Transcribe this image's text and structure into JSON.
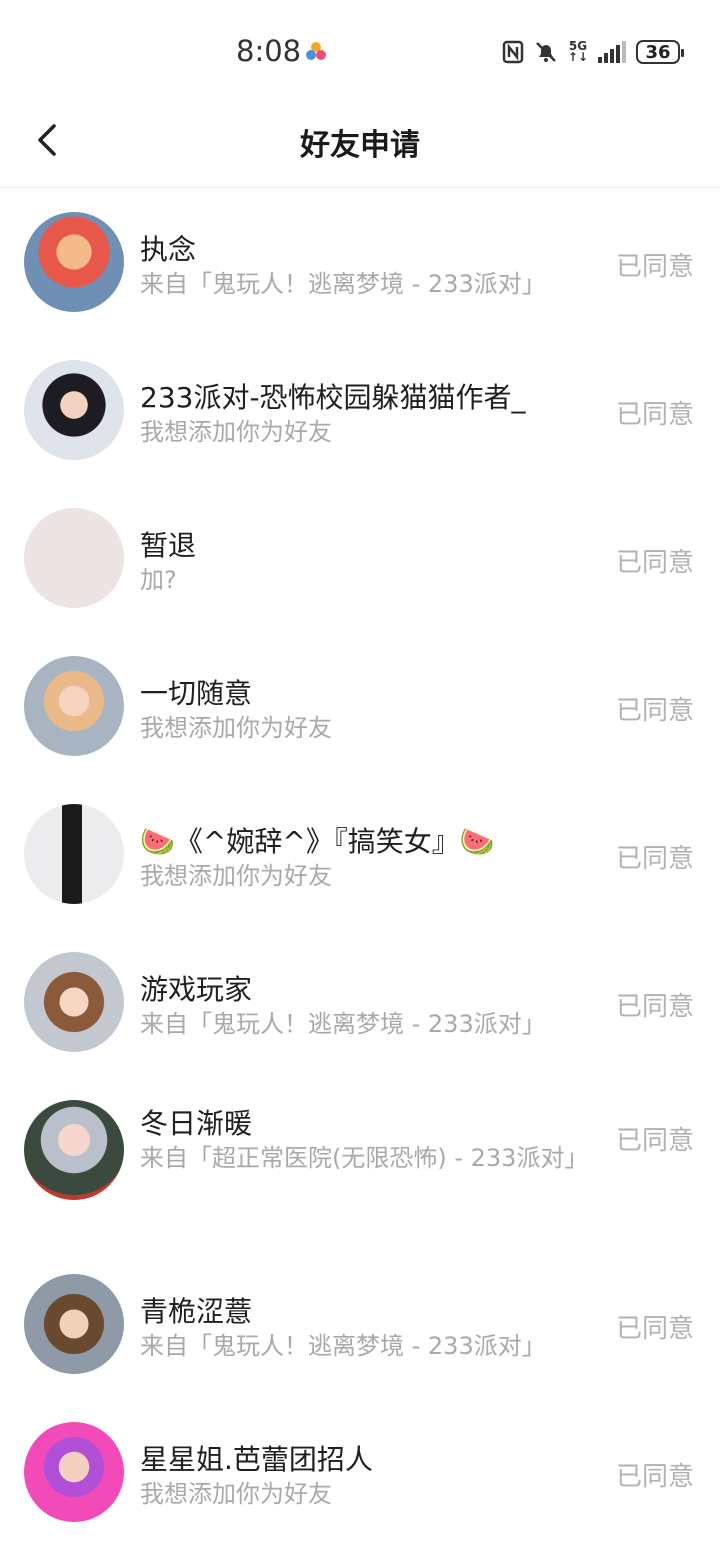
{
  "status_bar": {
    "time": "8:08",
    "network": "5G",
    "battery": "36"
  },
  "header": {
    "title": "好友申请"
  },
  "requests": [
    {
      "name": "执念",
      "message": "来自「鬼玩人！逃离梦境 - 233派对」",
      "status": "已同意"
    },
    {
      "name": "233派对-恐怖校园躲猫猫作者_",
      "message": "我想添加你为好友",
      "status": "已同意"
    },
    {
      "name": "暂退",
      "message": "加?",
      "status": "已同意"
    },
    {
      "name": "一切随意",
      "message": "我想添加你为好友",
      "status": "已同意"
    },
    {
      "name": "🍉《^婉辞^》『搞笑女』🍉",
      "message": "我想添加你为好友",
      "status": "已同意"
    },
    {
      "name": "游戏玩家",
      "message": "来自「鬼玩人！逃离梦境 - 233派对」",
      "status": "已同意"
    },
    {
      "name": "冬日渐暖",
      "message": "来自「超正常医院(无限恐怖) - 233派对」",
      "status": "已同意"
    },
    {
      "name": "青桅涩薏",
      "message": "来自「鬼玩人！逃离梦境 - 233派对」",
      "status": "已同意"
    },
    {
      "name": "星星姐.芭蕾团招人",
      "message": "我想添加你为好友",
      "status": "已同意"
    }
  ]
}
